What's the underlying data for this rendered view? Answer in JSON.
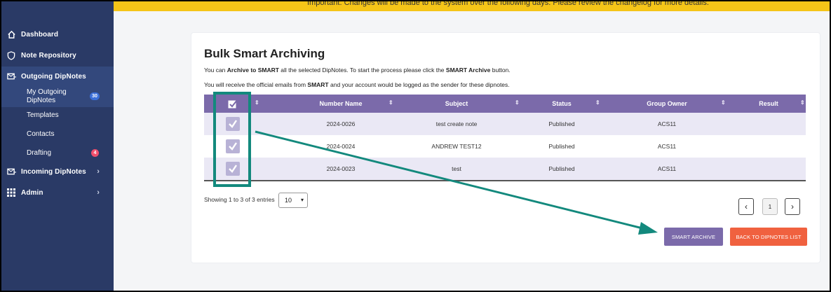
{
  "banner": {
    "text": "Important: Changes will be made to the system over the following days. Please review the changelog for more details."
  },
  "sidebar": {
    "items": [
      {
        "label": "Dashboard",
        "icon": "home-icon"
      },
      {
        "label": "Note Repository",
        "icon": "shield-icon"
      },
      {
        "label": "Outgoing DipNotes",
        "icon": "mail-out-icon"
      },
      {
        "label": "Incoming DipNotes",
        "icon": "mail-in-icon"
      },
      {
        "label": "Admin",
        "icon": "grid-icon"
      }
    ],
    "sub_items": [
      {
        "label_line1": "My Outgoing",
        "label_line2": "DipNotes",
        "badge": "30"
      },
      {
        "label": "Templates"
      },
      {
        "label": "Contacts"
      },
      {
        "label": "Drafting",
        "badge": "4"
      }
    ]
  },
  "page": {
    "title": "Bulk Smart Archiving",
    "desc1_a": "You can ",
    "desc1_b": "Archive to SMART",
    "desc1_c": " all the selected DipNotes. To start the process please click the ",
    "desc1_d": "SMART Archive",
    "desc1_e": " button.",
    "desc2_a": "You will receive the official emails from ",
    "desc2_b": "SMART",
    "desc2_c": " and your account would be logged as the sender for these dipnotes."
  },
  "table": {
    "columns": [
      "Number Name",
      "Subject",
      "Status",
      "Group Owner",
      "Result"
    ],
    "rows": [
      {
        "number": "2024-0026",
        "subject": "test create note",
        "status": "Published",
        "owner": "ACS11",
        "result": ""
      },
      {
        "number": "2024-0024",
        "subject": "ANDREW TEST12",
        "status": "Published",
        "owner": "ACS11",
        "result": ""
      },
      {
        "number": "2024-0023",
        "subject": "test",
        "status": "Published",
        "owner": "ACS11",
        "result": ""
      }
    ]
  },
  "footer": {
    "showing": "Showing 1 to 3 of 3 entries",
    "page_size": "10",
    "current_page": "1",
    "prev": "‹",
    "next": "›"
  },
  "buttons": {
    "smart_archive": "SMART ARCHIVE",
    "back": "BACK TO DIPNOTES LIST"
  },
  "colors": {
    "sidebar": "#2a3a66",
    "header": "#7b6aaa",
    "smart_archive_btn": "#7b6aaa",
    "back_btn": "#f0613f",
    "annotation": "#13897d",
    "banner": "#f5c518"
  }
}
